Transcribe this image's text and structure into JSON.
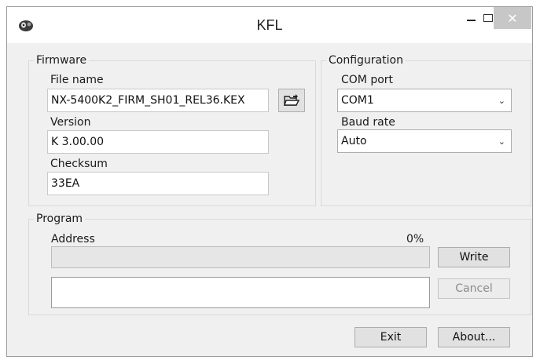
{
  "window": {
    "title": "KFL",
    "close_glyph": "✕",
    "icons": {
      "app": "kfl-app-icon",
      "minimize": "minimize-icon",
      "maximize": "maximize-icon",
      "close": "close-icon"
    }
  },
  "firmware": {
    "legend": "Firmware",
    "file_name_label": "File name",
    "file_name_value": "NX-5400K2_FIRM_SH01_REL36.KEX",
    "browse_icon": "open-folder-icon",
    "version_label": "Version",
    "version_value": "K 3.00.00",
    "checksum_label": "Checksum",
    "checksum_value": "33EA"
  },
  "configuration": {
    "legend": "Configuration",
    "com_port_label": "COM port",
    "com_port_value": "COM1",
    "baud_rate_label": "Baud rate",
    "baud_rate_value": "Auto",
    "dropdown_arrow": "⌄"
  },
  "program": {
    "legend": "Program",
    "address_label": "Address",
    "progress_text": "0%",
    "progress_value": 0,
    "write_label": "Write",
    "cancel_label": "Cancel",
    "log_text": ""
  },
  "footer": {
    "exit_label": "Exit",
    "about_label": "About..."
  }
}
